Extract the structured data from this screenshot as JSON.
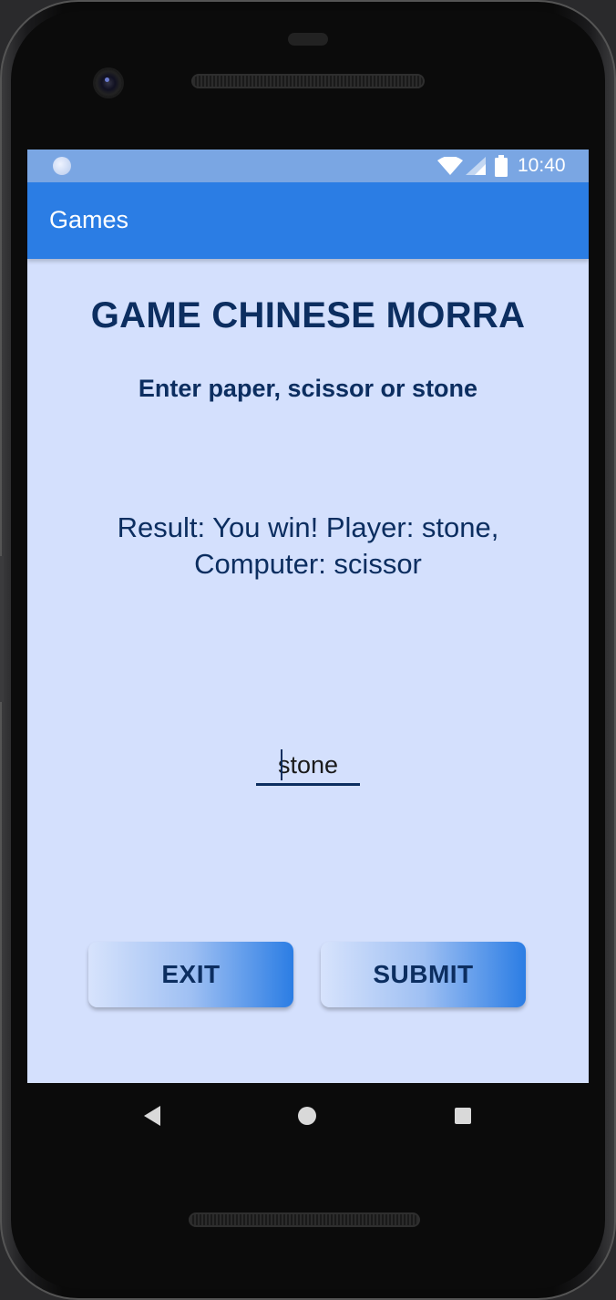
{
  "status_bar": {
    "time": "10:40",
    "icons": [
      "notification-dot-icon",
      "wifi-icon",
      "cell-signal-icon",
      "battery-icon"
    ]
  },
  "app_bar": {
    "title": "Games"
  },
  "main": {
    "title": "GAME CHINESE MORRA",
    "instruction": "Enter paper, scissor or stone",
    "result": "Result: You win! Player: stone, Computer: scissor",
    "input_value": "stone",
    "exit_label": "EXIT",
    "submit_label": "SUBMIT"
  },
  "nav_bar": {
    "icons": [
      "back-icon",
      "home-icon",
      "recents-icon"
    ]
  },
  "colors": {
    "status_bar": "#7aa6e3",
    "app_bar": "#2b7de4",
    "background": "#d4e0fd",
    "text_dark": "#0c2e60"
  }
}
